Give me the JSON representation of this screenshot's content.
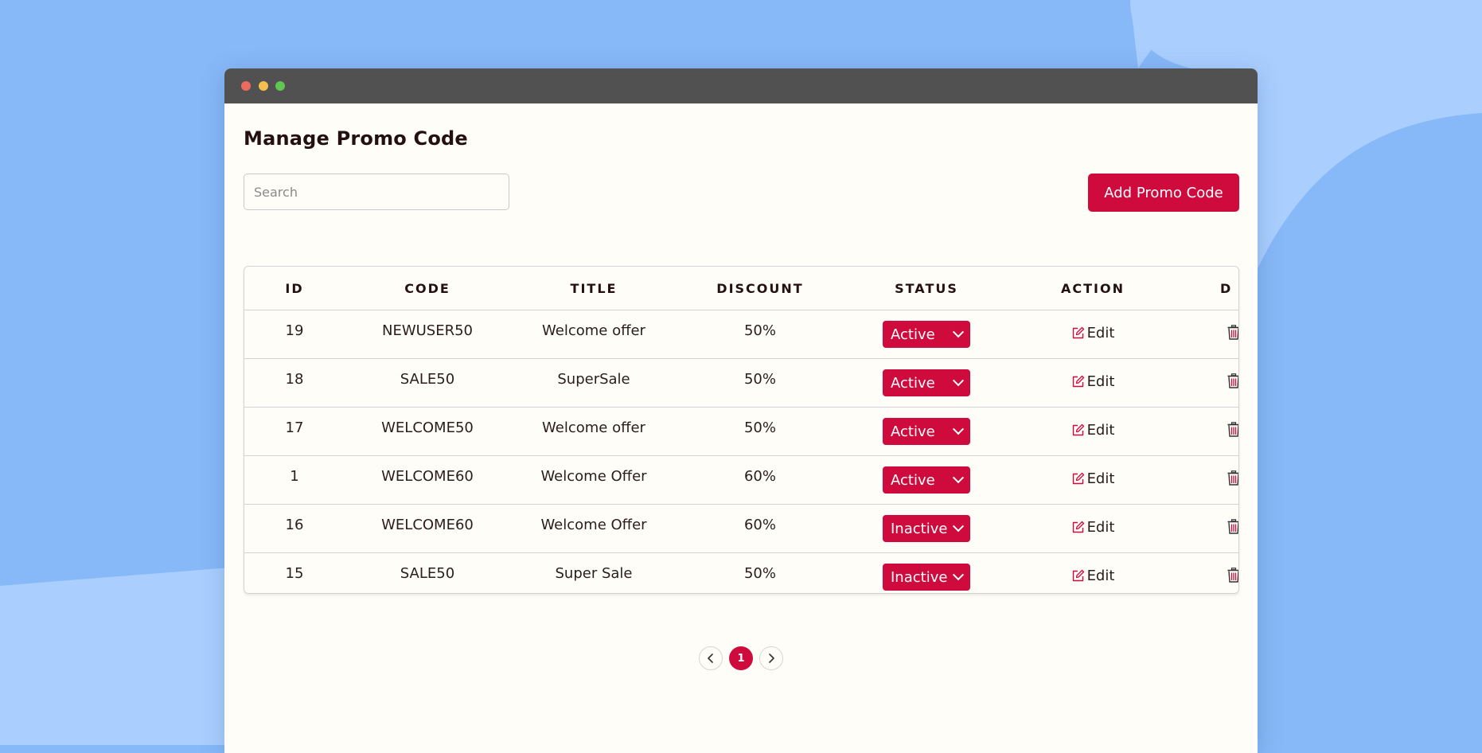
{
  "colors": {
    "background": "#87b8f7",
    "background_light": "#aacffe",
    "window_bg": "#fefdf8",
    "titlebar": "#515151",
    "accent": "#cf0a3c",
    "dot_red": "#ec6a5e",
    "dot_yellow": "#f4bf4f",
    "dot_green": "#61c554"
  },
  "page": {
    "title": "Manage Promo Code"
  },
  "search": {
    "placeholder": "Search",
    "value": ""
  },
  "toolbar": {
    "add_label": "Add Promo Code"
  },
  "table": {
    "columns": [
      "ID",
      "CODE",
      "TITLE",
      "DISCOUNT",
      "STATUS",
      "ACTION",
      "D"
    ],
    "rows": [
      {
        "id": "19",
        "code": "NEWUSER50",
        "title": "Welcome offer",
        "discount": "50%",
        "status": "Active",
        "action": "Edit"
      },
      {
        "id": "18",
        "code": "SALE50",
        "title": "SuperSale",
        "discount": "50%",
        "status": "Active",
        "action": "Edit"
      },
      {
        "id": "17",
        "code": "WELCOME50",
        "title": "Welcome offer",
        "discount": "50%",
        "status": "Active",
        "action": "Edit"
      },
      {
        "id": "1",
        "code": "WELCOME60",
        "title": "Welcome Offer",
        "discount": "60%",
        "status": "Active",
        "action": "Edit"
      },
      {
        "id": "16",
        "code": "WELCOME60",
        "title": "Welcome Offer",
        "discount": "60%",
        "status": "Inactive",
        "action": "Edit"
      },
      {
        "id": "15",
        "code": "SALE50",
        "title": "Super Sale",
        "discount": "50%",
        "status": "Inactive",
        "action": "Edit"
      }
    ],
    "icons": {
      "edit": "edit-icon",
      "delete": "trash-icon",
      "status_dropdown": "chevron-down-icon"
    }
  },
  "pagination": {
    "current_page": "1",
    "prev_icon": "chevron-left-icon",
    "next_icon": "chevron-right-icon"
  }
}
